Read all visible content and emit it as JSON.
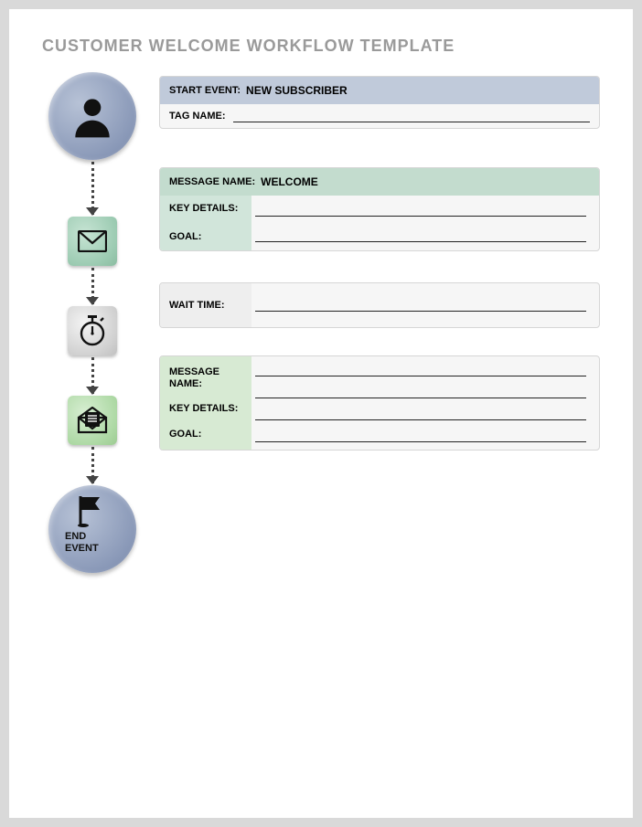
{
  "title": "CUSTOMER WELCOME WORKFLOW TEMPLATE",
  "start": {
    "start_label": "START EVENT:",
    "start_value": "NEW SUBSCRIBER",
    "tag_label": "TAG NAME:"
  },
  "msg1": {
    "name_label": "MESSAGE NAME:",
    "name_value": "WELCOME",
    "details_label": "KEY DETAILS:",
    "goal_label": "GOAL:"
  },
  "wait": {
    "label": "WAIT TIME:"
  },
  "msg2": {
    "name_label": "MESSAGE NAME:",
    "details_label": "KEY DETAILS:",
    "goal_label": "GOAL:"
  },
  "end": {
    "label": "END EVENT"
  }
}
